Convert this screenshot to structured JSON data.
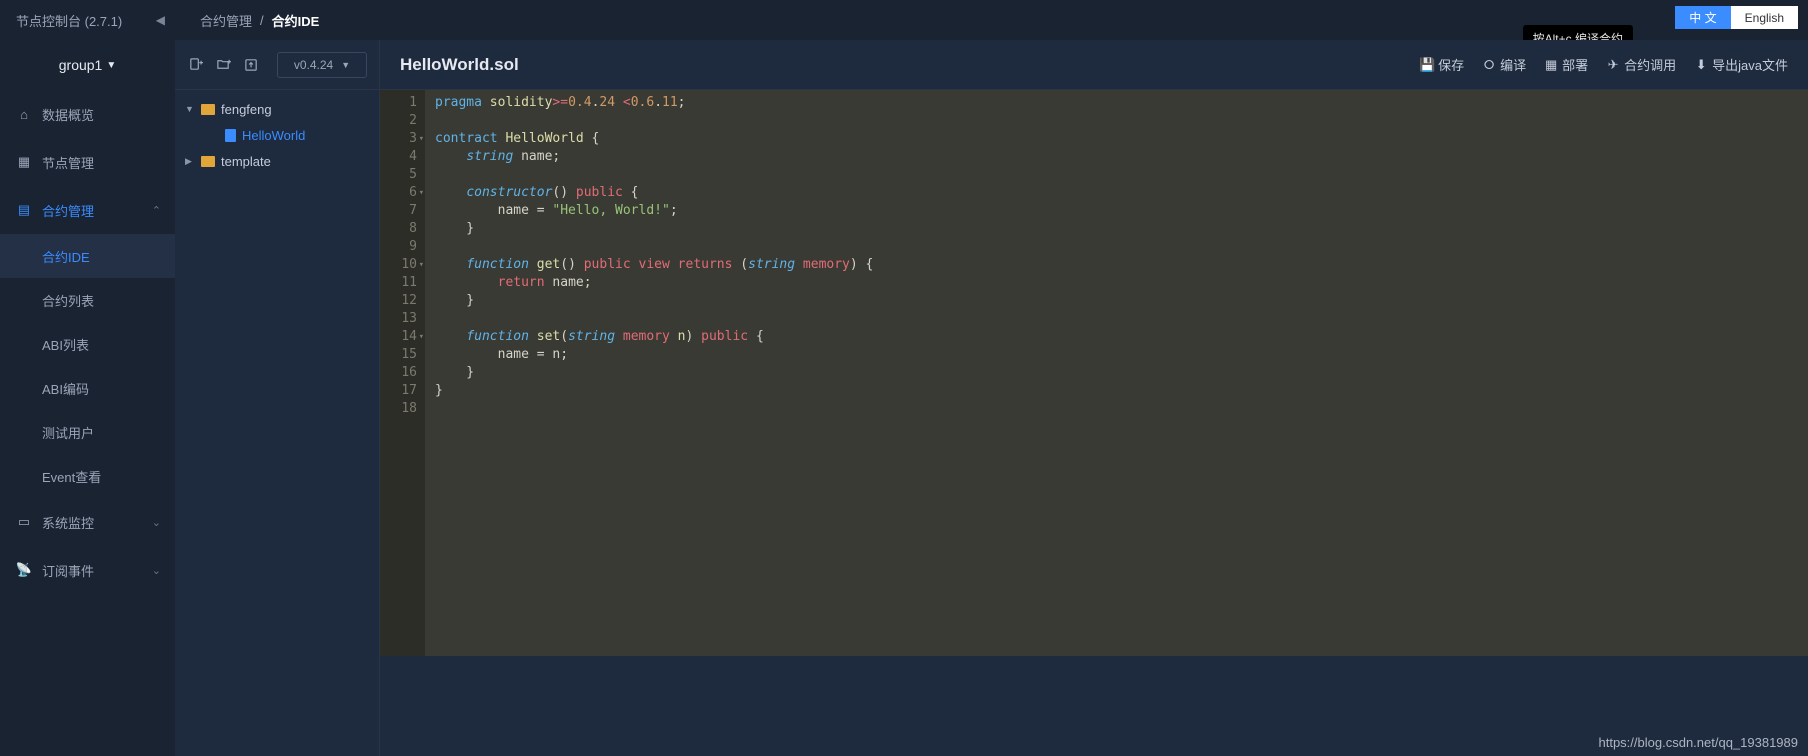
{
  "header": {
    "console_title": "节点控制台 (2.7.1)",
    "breadcrumb_parent": "合约管理",
    "breadcrumb_sep": "/",
    "breadcrumb_current": "合约IDE",
    "tooltip": "按Alt+c 编译合约",
    "lang_zh": "中 文",
    "lang_en": "English"
  },
  "sidebar": {
    "group": "group1",
    "items": {
      "overview": "数据概览",
      "node_mgmt": "节点管理",
      "contract_mgmt": "合约管理",
      "contract_ide": "合约IDE",
      "contract_list": "合约列表",
      "abi_list": "ABI列表",
      "abi_encode": "ABI编码",
      "test_user": "测试用户",
      "event_view": "Event查看",
      "system_monitor": "系统监控",
      "subscribe": "订阅事件"
    }
  },
  "explorer": {
    "version": "v0.4.24",
    "tree": {
      "folder1": "fengfeng",
      "file1": "HelloWorld",
      "folder2": "template"
    }
  },
  "editor": {
    "title": "HelloWorld.sol",
    "btn_save": "保存",
    "btn_compile": "编译",
    "btn_deploy": "部署",
    "btn_invoke": "合约调用",
    "btn_export": "导出java文件"
  },
  "code": {
    "lines": [
      "1",
      "2",
      "3",
      "4",
      "5",
      "6",
      "7",
      "8",
      "9",
      "10",
      "11",
      "12",
      "13",
      "14",
      "15",
      "16",
      "17",
      "18"
    ],
    "fold_lines": [
      3,
      6,
      10,
      14
    ]
  },
  "watermark": "https://blog.csdn.net/qq_19381989"
}
